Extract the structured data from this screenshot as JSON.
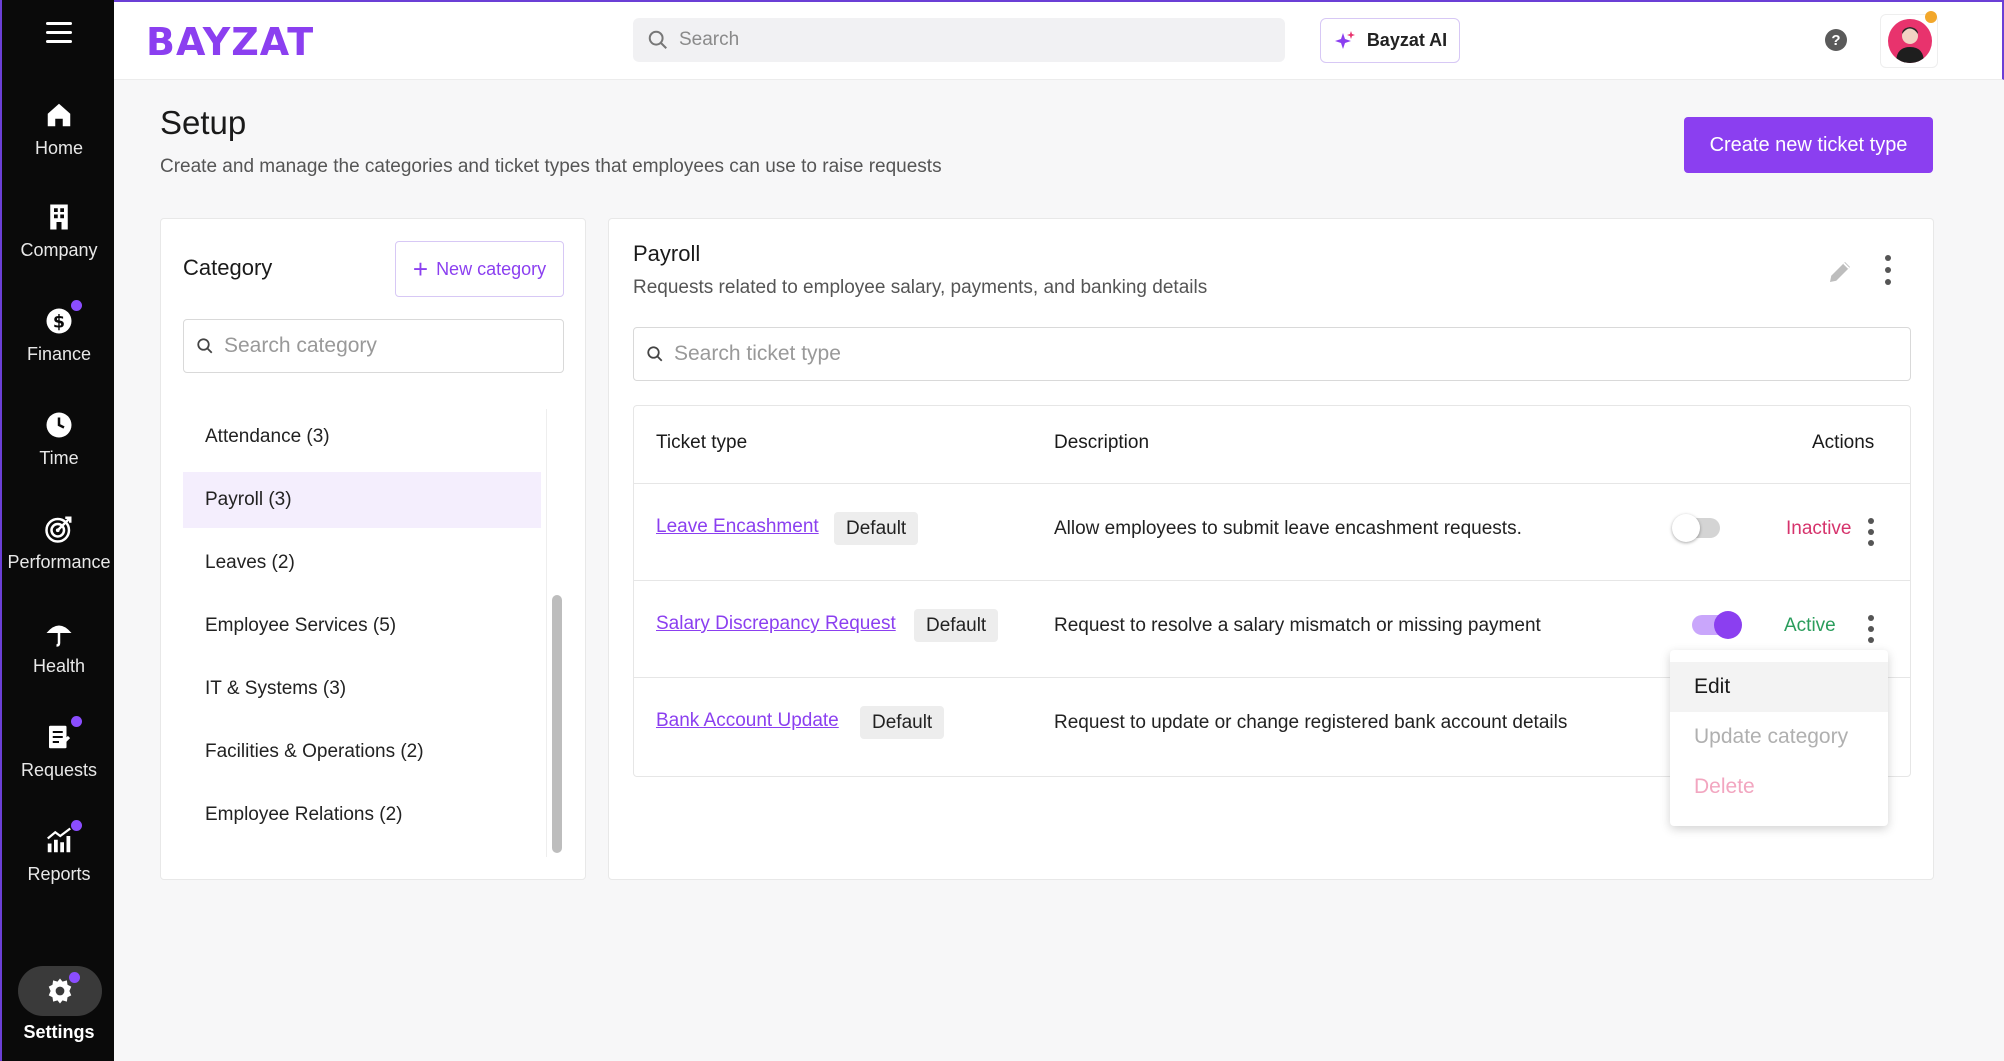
{
  "nav": {
    "items": [
      {
        "label": "Home",
        "icon": "home-icon"
      },
      {
        "label": "Company",
        "icon": "building-icon"
      },
      {
        "label": "Finance",
        "icon": "dollar-icon"
      },
      {
        "label": "Time",
        "icon": "clock-icon"
      },
      {
        "label": "Performance",
        "icon": "target-icon"
      },
      {
        "label": "Health",
        "icon": "umbrella-icon"
      },
      {
        "label": "Requests",
        "icon": "clipboard-icon"
      },
      {
        "label": "Reports",
        "icon": "chart-icon"
      }
    ],
    "settings_label": "Settings"
  },
  "topbar": {
    "logo": "BAYZAT",
    "search_placeholder": "Search",
    "ai_label": "Bayzat AI",
    "help": "?"
  },
  "page": {
    "title": "Setup",
    "subtitle": "Create and manage the categories and ticket types that employees can use to raise requests",
    "create_button": "Create new ticket type"
  },
  "categories": {
    "title": "Category",
    "new_button": "New category",
    "search_placeholder": "Search category",
    "items": [
      {
        "label": "Attendance (3)"
      },
      {
        "label": "Payroll (3)",
        "selected": true
      },
      {
        "label": "Leaves (2)"
      },
      {
        "label": "Employee Services (5)"
      },
      {
        "label": "IT & Systems (3)"
      },
      {
        "label": "Facilities & Operations (2)"
      },
      {
        "label": "Employee Relations (2)"
      }
    ]
  },
  "main": {
    "title": "Payroll",
    "subtitle": "Requests related to employee salary, payments, and banking details",
    "search_placeholder": "Search ticket type",
    "columns": [
      "Ticket type",
      "Description",
      "Actions"
    ],
    "rows": [
      {
        "name": "Leave Encashment",
        "badge": "Default",
        "description": "Allow employees to submit leave encashment requests.",
        "status": "Inactive",
        "active": false
      },
      {
        "name": "Salary Discrepancy Request",
        "badge": "Default",
        "description": "Request to resolve a salary mismatch or missing payment",
        "status": "Active",
        "active": true
      },
      {
        "name": "Bank Account Update",
        "badge": "Default",
        "description": "Request to update or change registered bank account details",
        "status": "",
        "active": null
      }
    ]
  },
  "menu": {
    "items": [
      "Edit",
      "Update category",
      "Delete"
    ]
  },
  "colors": {
    "accent": "#8b3ff0",
    "active": "#2a9d5c",
    "inactive": "#d6336c"
  }
}
